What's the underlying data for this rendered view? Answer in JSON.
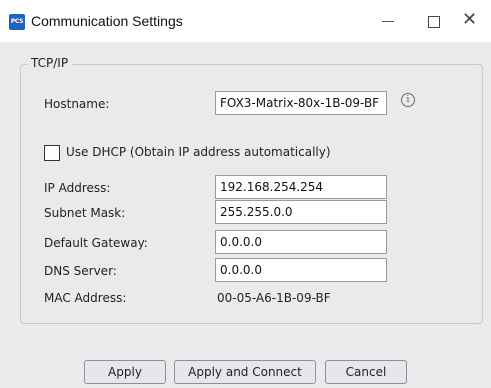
{
  "window": {
    "title": "Communication Settings",
    "icon_text": "PCS",
    "minimize_glyph": "—",
    "maximize_glyph": "☐",
    "close_glyph": "✕"
  },
  "group": {
    "legend": "TCP/IP"
  },
  "hostname": {
    "label": "Hostname:",
    "value": "FOX3-Matrix-80x-1B-09-BF",
    "info_glyph": "i"
  },
  "dhcp": {
    "label": "Use DHCP (Obtain IP address automatically)",
    "checked": false
  },
  "fields": {
    "ip_label": "IP Address:",
    "ip_value": "192.168.254.254",
    "subnet_label": "Subnet Mask:",
    "subnet_value": "255.255.0.0",
    "gateway_label": "Default Gateway:",
    "gateway_value": "0.0.0.0",
    "dns_label": "DNS Server:",
    "dns_value": "0.0.0.0",
    "mac_label": "MAC Address:",
    "mac_value": "00-05-A6-1B-09-BF"
  },
  "buttons": {
    "apply": "Apply",
    "apply_connect": "Apply and Connect",
    "cancel": "Cancel"
  }
}
